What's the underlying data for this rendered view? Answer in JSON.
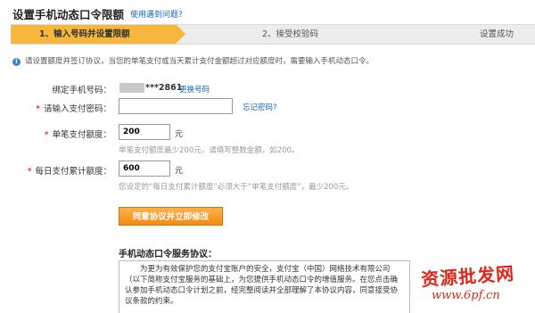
{
  "header": {
    "title": "设置手机动态口令限额",
    "help_link": "使用遇到问题?"
  },
  "steps": [
    {
      "label": "1、输入号码并设置限额"
    },
    {
      "label": "2、接受校验码"
    },
    {
      "label": "设置成功"
    }
  ],
  "notice": "请设置额度并签订协议，当您的单笔支付或当天累计支付金额超过对应额度时，需要输入手机动态口令。",
  "form": {
    "phone_label": "绑定手机号码：",
    "phone_suffix": "***2861",
    "change_link": "更换号码",
    "password_label": "请输入支付密码：",
    "password_value": "",
    "forgot_link": "忘记密码?",
    "single_label": "单笔支付额度：",
    "single_value": "200",
    "unit": "元",
    "single_hint": "单笔支付额度最少200元，请填写整数金额，如200。",
    "daily_label": "每日支付累计额度：",
    "daily_value": "600",
    "daily_hint": "您设定的“每日支付累计额度”必须大于“单笔支付额度”，最少200元。",
    "submit_label": "同意协议并立即修改"
  },
  "agreement": {
    "title": "手机动态口令服务协议：",
    "lines": [
      "为更为有效保护您的支付宝账户的安全，支付宝（中国）网络技术有限公司（以下简称支付宝服务的基础上，为您提供手机动态口令的增值服务。在您点击确认参加手机动态口令计划之前，经完整阅读并全部理解了本协议内容，同意接受协议条款的约束。"
    ]
  },
  "watermark": {
    "text": "资源批发网",
    "url": "www.6pf.cn"
  },
  "colors": {
    "active_step": "#f6b73c",
    "link": "#1a64b4",
    "required": "#e00000",
    "button": "#f18a13"
  }
}
